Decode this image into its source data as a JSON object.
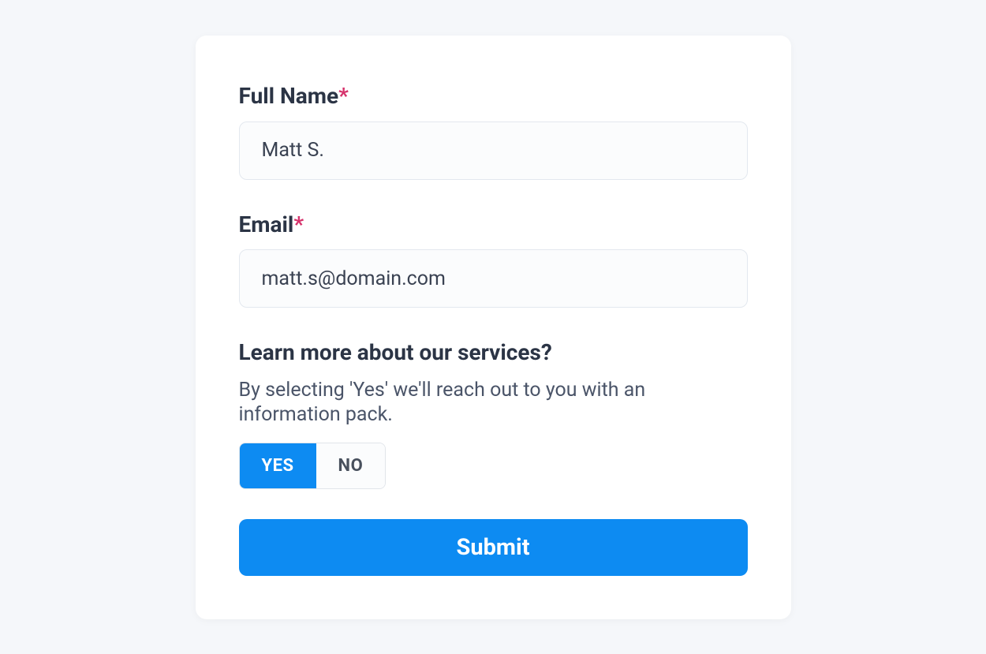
{
  "form": {
    "full_name": {
      "label": "Full Name",
      "value": "Matt S.",
      "required_mark": "*"
    },
    "email": {
      "label": "Email",
      "value": "matt.s@domain.com",
      "required_mark": "*"
    },
    "learn_more": {
      "label": "Learn more about our services?",
      "helper": "By selecting 'Yes' we'll reach out to you with an information pack.",
      "options": {
        "yes": "YES",
        "no": "NO"
      },
      "selected": "yes"
    },
    "submit_label": "Submit"
  }
}
